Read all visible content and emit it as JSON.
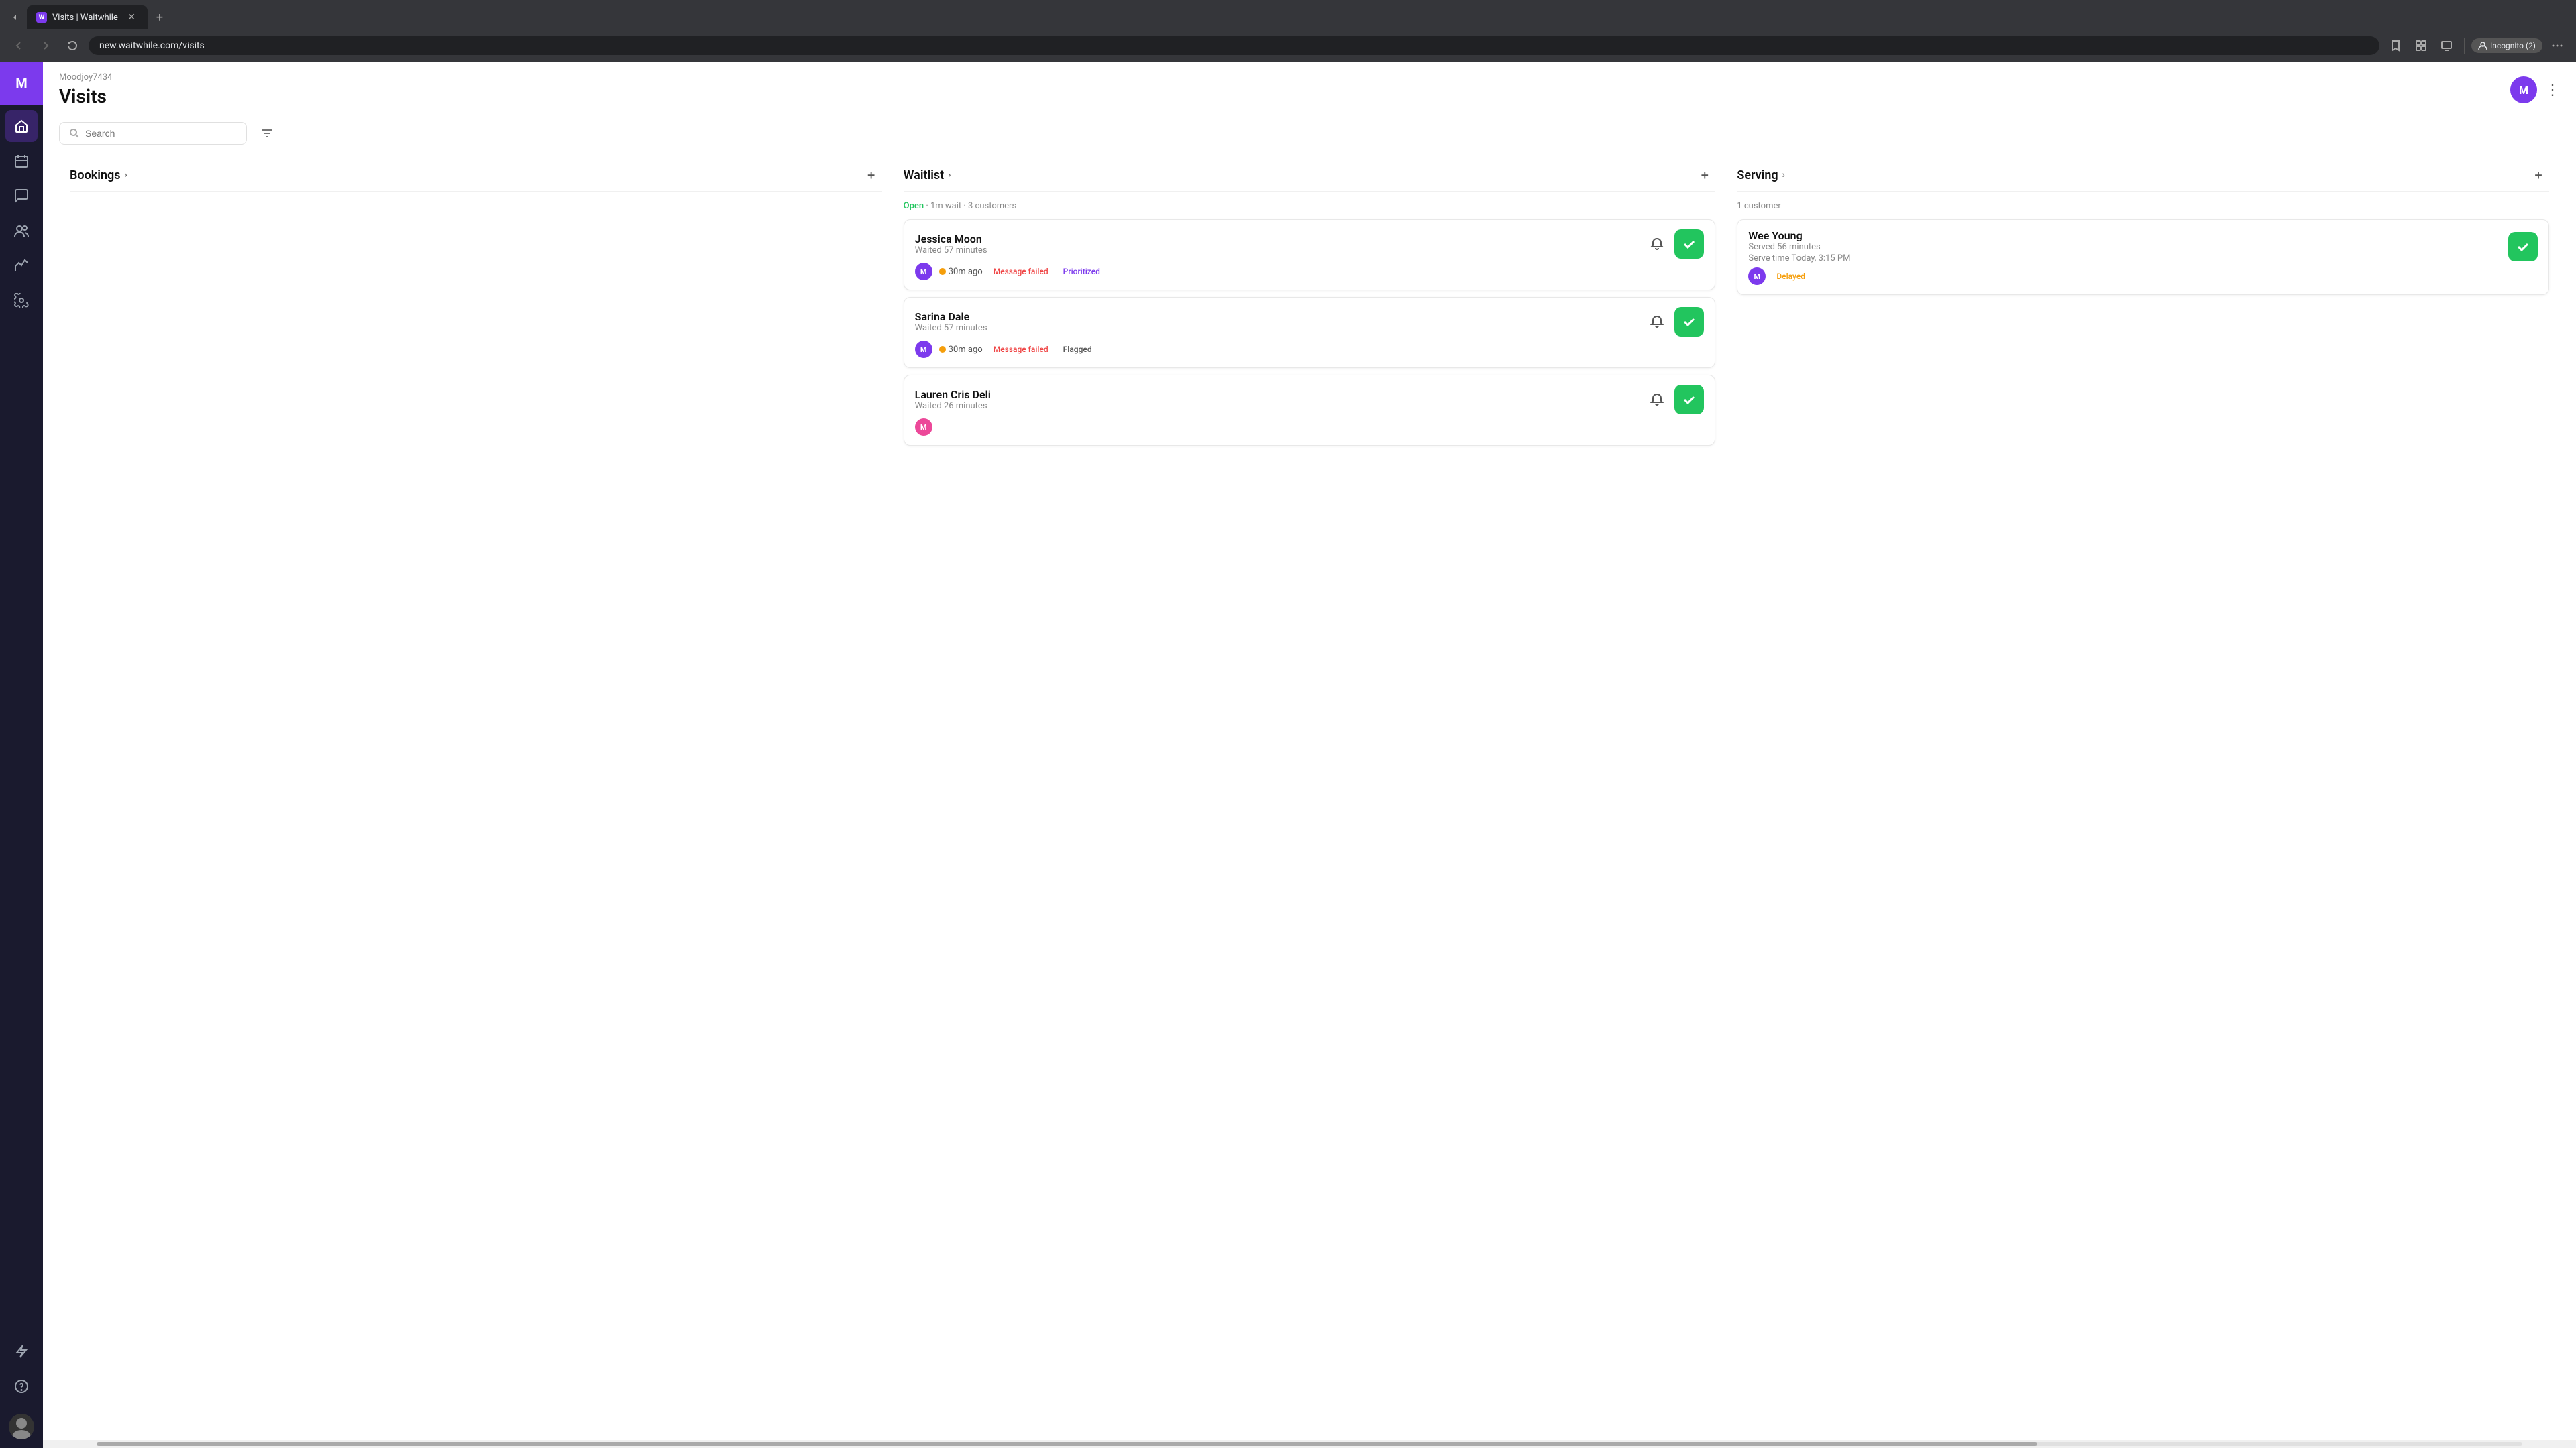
{
  "browser": {
    "tab_favicon": "W",
    "tab_title": "Visits | Waitwhile",
    "address": "new.waitwhile.com/visits",
    "incognito_label": "Incognito (2)"
  },
  "sidebar": {
    "logo_letter": "M",
    "items": [
      {
        "id": "home",
        "icon": "home"
      },
      {
        "id": "calendar",
        "icon": "calendar"
      },
      {
        "id": "chat",
        "icon": "chat"
      },
      {
        "id": "users",
        "icon": "users"
      },
      {
        "id": "analytics",
        "icon": "analytics"
      },
      {
        "id": "settings",
        "icon": "settings"
      }
    ],
    "bottom_items": [
      {
        "id": "bolt",
        "icon": "bolt"
      },
      {
        "id": "help",
        "icon": "help"
      }
    ]
  },
  "header": {
    "org_name": "Moodjoy7434",
    "page_title": "Visits",
    "user_initial": "M",
    "more_icon": "⋮"
  },
  "toolbar": {
    "search_placeholder": "Search",
    "filter_icon": "filter"
  },
  "columns": [
    {
      "id": "bookings",
      "title": "Bookings",
      "add_label": "+",
      "meta": null,
      "cards": []
    },
    {
      "id": "waitlist",
      "title": "Waitlist",
      "add_label": "+",
      "meta_open": "Open",
      "meta_suffix": " · 1m wait · 3 customers",
      "cards": [
        {
          "id": "jessica-moon",
          "name": "Jessica Moon",
          "waited": "Waited 57 minutes",
          "avatar_color": "#7c3aed",
          "avatar_letter": "M",
          "time_ago": "30m ago",
          "tag1": "Message failed",
          "tag1_type": "failed",
          "tag2": "Prioritized",
          "tag2_type": "prioritized"
        },
        {
          "id": "sarina-dale",
          "name": "Sarina Dale",
          "waited": "Waited 57 minutes",
          "avatar_color": "#7c3aed",
          "avatar_letter": "M",
          "time_ago": "30m ago",
          "tag1": "Message failed",
          "tag1_type": "failed",
          "tag2": "Flagged",
          "tag2_type": "flagged"
        },
        {
          "id": "lauren-cris-deli",
          "name": "Lauren Cris Deli",
          "waited": "Waited 26 minutes",
          "avatar_color": "#ec4899",
          "avatar_letter": "M",
          "time_ago": null,
          "tag1": null,
          "tag2": null
        }
      ]
    },
    {
      "id": "serving",
      "title": "Serving",
      "add_label": "+",
      "meta": "1 customer",
      "cards": [
        {
          "id": "wee-young",
          "name": "Wee Young",
          "waited": "Served 56 minutes",
          "serve_time": "Serve time Today, 3:15 PM",
          "avatar_color": "#7c3aed",
          "avatar_letter": "M",
          "tag1": "Delayed",
          "tag1_type": "delayed"
        }
      ]
    }
  ]
}
